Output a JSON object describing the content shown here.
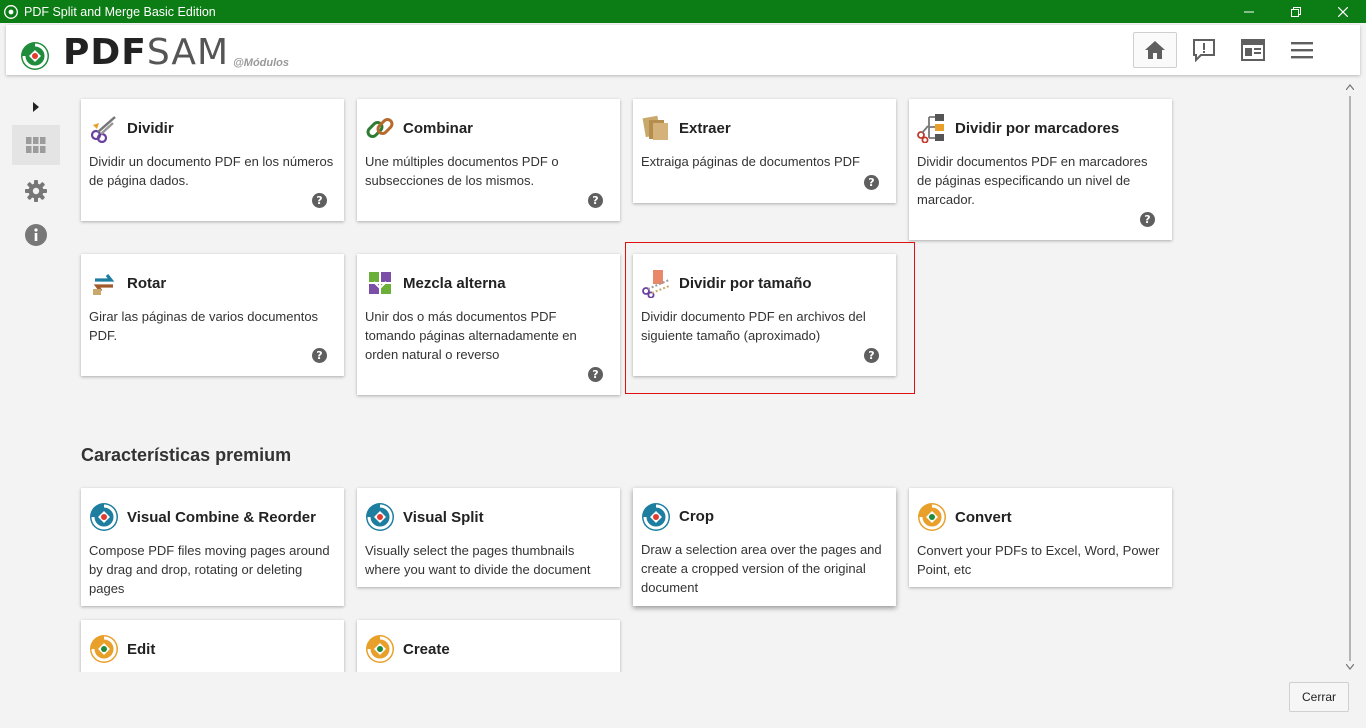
{
  "window": {
    "title": "PDF Split and Merge Basic Edition"
  },
  "brand": {
    "name_bold": "PDF",
    "name_light": "SAM",
    "subtitle": "@Módulos"
  },
  "modules": [
    {
      "title": "Dividir",
      "desc": "Dividir un documento PDF en los números de página dados.",
      "icon": "scissors-icon"
    },
    {
      "title": "Combinar",
      "desc": "Une múltiples documentos PDF o subsecciones de los mismos.",
      "icon": "chain-link-icon"
    },
    {
      "title": "Extraer",
      "desc": "Extraiga páginas de documentos PDF",
      "icon": "extract-pages-icon"
    },
    {
      "title": "Dividir por marcadores",
      "desc": "Dividir documentos PDF en marcadores de páginas especificando un nivel de marcador.",
      "icon": "bookmark-tree-icon"
    },
    {
      "title": "Rotar",
      "desc": "Girar las páginas de varios documentos PDF.",
      "icon": "rotate-icon"
    },
    {
      "title": "Mezcla alterna",
      "desc": "Unir dos o más documentos PDF tomando páginas alternadamente en orden natural o reverso",
      "icon": "alternate-mix-icon"
    },
    {
      "title": "Dividir por tamaño",
      "desc": "Dividir documento PDF en archivos del siguiente tamaño (aproximado)",
      "icon": "split-by-size-icon"
    }
  ],
  "premium": {
    "section_title": "Características premium",
    "items": [
      {
        "title": "Visual Combine & Reorder",
        "desc": "Compose PDF files moving pages around by drag and drop, rotating or deleting pages",
        "icon": "pdfsam-blue-icon"
      },
      {
        "title": "Visual Split",
        "desc": "Visually select the pages thumbnails where you want to divide the document",
        "icon": "pdfsam-blue-icon"
      },
      {
        "title": "Crop",
        "desc": "Draw a selection area over the pages and create a cropped version of the original document",
        "icon": "pdfsam-blue-icon"
      },
      {
        "title": "Convert",
        "desc": "Convert your PDFs to Excel, Word, Power Point, etc",
        "icon": "pdfsam-orange-icon"
      },
      {
        "title": "Edit",
        "desc": "",
        "icon": "pdfsam-orange-icon"
      },
      {
        "title": "Create",
        "desc": "",
        "icon": "pdfsam-orange-icon"
      }
    ]
  },
  "help_glyph": "?",
  "footer": {
    "close_label": "Cerrar"
  },
  "colors": {
    "titlebar": "#0c7c14",
    "highlight": "#e01010",
    "accent_green": "#1e8c3a",
    "accent_blue": "#1d7ea0",
    "accent_orange": "#e8a02a"
  }
}
